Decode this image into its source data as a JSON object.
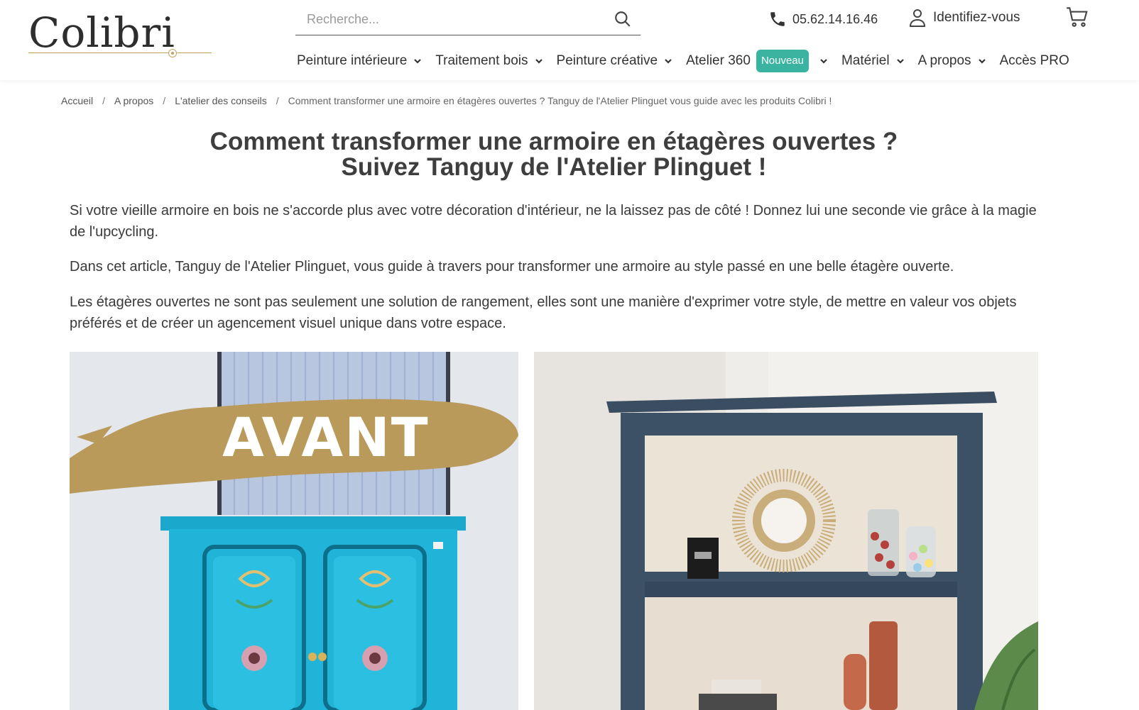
{
  "brand": {
    "name": "Colibri",
    "accent": "#c2a45f"
  },
  "search": {
    "placeholder": "Recherche...",
    "icon": "search-icon"
  },
  "contact": {
    "phone": "05.62.14.16.46",
    "phone_icon": "phone-icon"
  },
  "account": {
    "label": "Identifiez-vous",
    "icon": "user-icon"
  },
  "cart": {
    "icon": "cart-icon"
  },
  "nav": {
    "items": [
      {
        "label": "Peinture intérieure",
        "has_dropdown": true
      },
      {
        "label": "Traitement bois",
        "has_dropdown": true
      },
      {
        "label": "Peinture créative",
        "has_dropdown": true
      },
      {
        "label": "Atelier 360",
        "badge": "Nouveau",
        "has_dropdown": true
      },
      {
        "label": "Matériel",
        "has_dropdown": true
      },
      {
        "label": "A propos",
        "has_dropdown": true
      },
      {
        "label": "Accès PRO",
        "has_dropdown": false
      }
    ],
    "badge_color": "#3ab4a0"
  },
  "breadcrumb": {
    "items": [
      "Accueil",
      "A propos",
      "L'atelier des conseils",
      "Comment transformer une armoire en étagères ouvertes ? Tanguy de l'Atelier Plinguet vous guide avec les produits Colibri !"
    ],
    "separator": "/"
  },
  "article": {
    "title_line1": "Comment transformer une armoire en étagères ouvertes ?",
    "title_line2": "Suivez Tanguy de l'Atelier Plinguet !",
    "paragraphs": [
      "Si votre vieille armoire en bois ne s'accorde plus avec votre décoration d'intérieur, ne la laissez pas de côté ! Donnez lui une seconde vie grâce à la magie de l'upcycling.",
      "Dans cet article, Tanguy de l'Atelier Plinguet, vous guide à travers pour transformer une armoire au style passé en une belle étagère ouverte.",
      "Les étagères ouvertes ne sont pas seulement une solution de rangement, elles sont une manière d'exprimer votre style, de mettre en valeur vos objets préférés et de créer un agencement visuel unique dans votre espace."
    ],
    "before_label": "AVANT",
    "before_image_color": "#1fb4d8",
    "after_image_color": "#3d5166"
  }
}
